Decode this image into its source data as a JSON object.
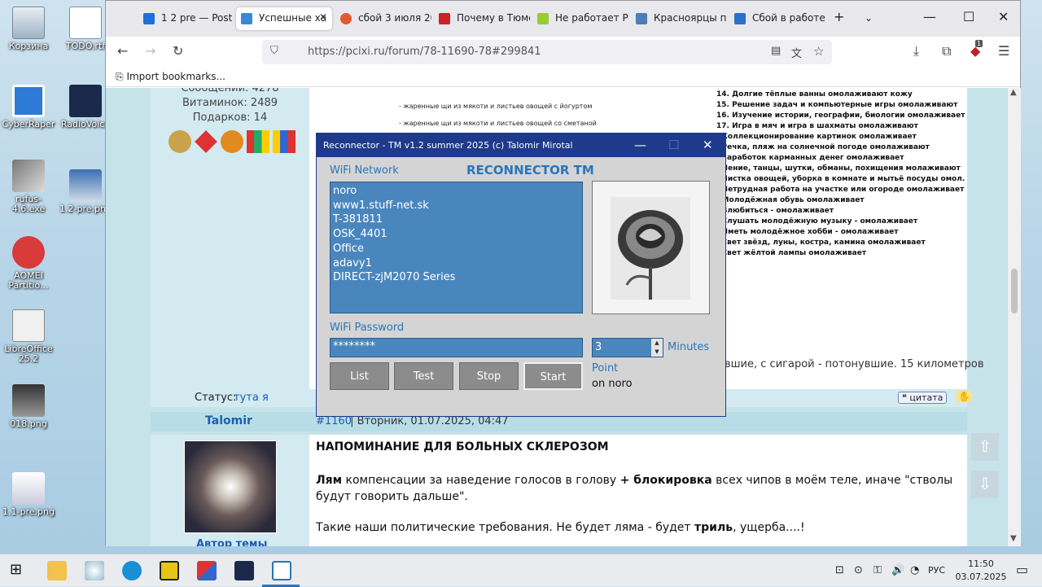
{
  "desktop": {
    "icons": [
      {
        "label": "Корзина"
      },
      {
        "label": "TODO.rtf"
      },
      {
        "label": "CyberRaper"
      },
      {
        "label": "RadioVoice"
      },
      {
        "label": "rufus-4.6.exe"
      },
      {
        "label": "1.2-pre.png"
      },
      {
        "label": "AOMEI Partitio..."
      },
      {
        "label": "LibreOffice 25.2"
      },
      {
        "label": "018.png"
      },
      {
        "label": "1.1-pre.png"
      }
    ]
  },
  "browser": {
    "tabs": [
      {
        "label": "1 2 pre — Postin"
      },
      {
        "label": "Успешные ха"
      },
      {
        "label": "сбой 3 июля 20"
      },
      {
        "label": "Почему в Тюме"
      },
      {
        "label": "Не работает Ро"
      },
      {
        "label": "Красноярцы по"
      },
      {
        "label": "Сбой в работе"
      }
    ],
    "url": "https://pcixi.ru/forum/78-11690-78#299841",
    "bookmarks": {
      "import": "Import bookmarks..."
    },
    "ext_badge": "1"
  },
  "forum": {
    "user_stats": {
      "messages": "Сообщений: 4278",
      "vitamins": "Витаминок: 2489",
      "gifts": "Подарков: 14"
    },
    "recipe_lines": [
      "- жаренные щи из мякоти и листьев овощей с йогуртом",
      "- жаренные щи из мякоти и листьев овощей со сметаной"
    ],
    "list_items": [
      "14. Долгие тёплые ванны омолаживают кожу",
      "15. Решение задач и компьютерные игры омолаживают",
      "16. Изучение истории, географии, биологии омолаживает",
      "17. Игра в мяч и игра в шахматы омолаживают",
      ". Коллекционирование картинок омолаживает",
      ". Речка, пляж на солнечной погоде омолаживают",
      ". Заработок карманных денег омолаживает",
      ". Пение, танцы, шутки, обманы, похищения молаживают",
      ". Чистка овощей, уборка в комнате и мытьё посуды омол.",
      ". Нетрудная работа на участке или огороде омолаживает",
      ". Молодёжная обувь омолаживает",
      ". Влюбиться - омолаживает",
      ". Слушать молодёжную музыку - омолаживает",
      ". Иметь молодёжное хобби - омолаживает",
      ". Свет звёзд, луны, костра, камина омолаживает",
      ". Свет жёлтой лампы омолаживает"
    ],
    "text_tail": "вшие, с сигарой - потонувшие. 15 километров",
    "status_label": "Статус:",
    "status_value": "тута я",
    "quote": "цитата",
    "post": {
      "author": "Talomir",
      "number": "#1160",
      "date": " | Вторник, 01.07.2025, 04:47",
      "author_caption": "Автор темы",
      "heading": "НАПОМИНАНИЕ ДЛЯ БОЛЬНЫХ СКЛЕРОЗОМ",
      "p1_b1": "Лям",
      "p1_t1": " компенсации за наведение голосов в голову ",
      "p1_b2": "+ блокировка",
      "p1_t2": " всех чипов в моём теле, иначе \"стволы будут говорить дальше\".",
      "p2_t1": "Такие наши политические требования. Не будет ляма - будет ",
      "p2_b1": "триль",
      "p2_t2": ", ущерба....!"
    }
  },
  "dialog": {
    "title": "Reconnector - TM  v1.2  summer 2025  (c) Talomir Mirotal",
    "brand": "RECONNECTOR TM",
    "network_label": "WiFi Network",
    "networks": [
      "noro",
      "www1.stuff-net.sk",
      "T-381811",
      "OSK_4401",
      "Office",
      "adavy1",
      "DIRECT-zjM2070 Series"
    ],
    "password_label": "WiFi Password",
    "password_value": "********",
    "minutes_value": "3",
    "minutes_label": "Minutes",
    "buttons": {
      "list": "List",
      "test": "Test",
      "stop": "Stop",
      "start": "Start"
    },
    "point_label": "Point",
    "point_value": "on noro"
  },
  "taskbar": {
    "lang": "РУС",
    "time": "11:50",
    "date": "03.07.2025"
  }
}
